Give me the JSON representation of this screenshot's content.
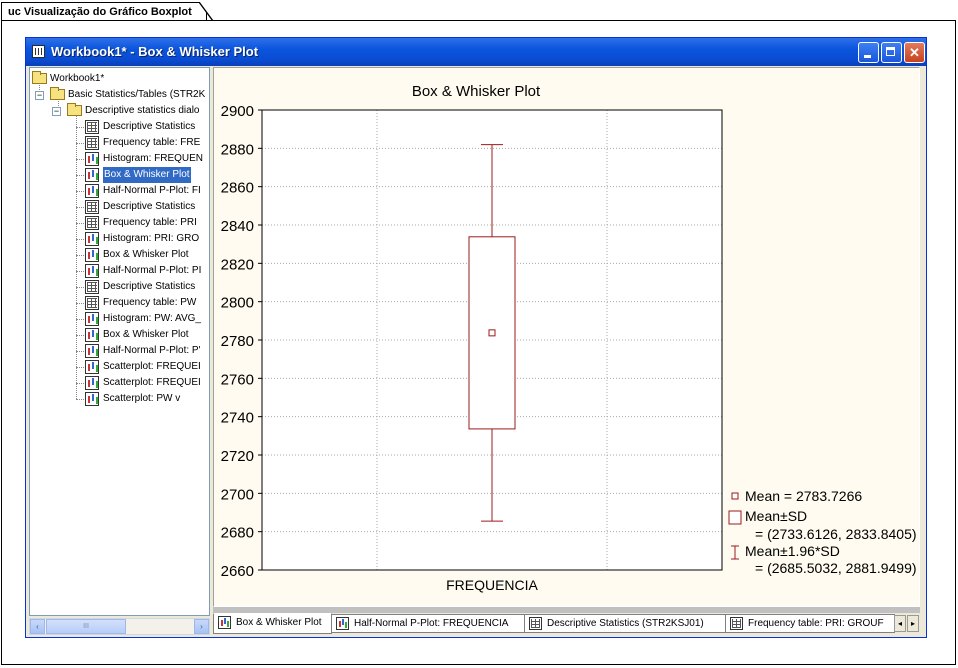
{
  "caption": {
    "title": "uc Visualização do Gráfico Boxplot"
  },
  "window": {
    "title": "Workbook1* - Box & Whisker Plot",
    "buttons": {
      "minimize": "minimize-icon",
      "maximize": "maximize-icon",
      "close": "close-icon"
    }
  },
  "tree": {
    "items": [
      {
        "label": "Workbook1*",
        "icon": "folder-icon"
      },
      {
        "label": "Basic Statistics/Tables (STR2K",
        "icon": "folder-icon"
      },
      {
        "label": "Descriptive statistics dialo",
        "icon": "folder-icon"
      },
      {
        "label": "Descriptive Statistics",
        "icon": "table-icon"
      },
      {
        "label": "Frequency table: FRE",
        "icon": "table-icon"
      },
      {
        "label": "Histogram: FREQUEN",
        "icon": "graph-icon"
      },
      {
        "label": "Box & Whisker Plot",
        "icon": "graph-icon"
      },
      {
        "label": "Half-Normal P-Plot: FI",
        "icon": "graph-icon"
      },
      {
        "label": "Descriptive Statistics",
        "icon": "table-icon"
      },
      {
        "label": "Frequency table: PRI",
        "icon": "table-icon"
      },
      {
        "label": "Histogram: PRI: GRO",
        "icon": "graph-icon"
      },
      {
        "label": "Box & Whisker Plot",
        "icon": "graph-icon"
      },
      {
        "label": "Half-Normal P-Plot: PI",
        "icon": "graph-icon"
      },
      {
        "label": "Descriptive Statistics",
        "icon": "table-icon"
      },
      {
        "label": "Frequency table: PW",
        "icon": "table-icon"
      },
      {
        "label": "Histogram: PW: AVG_",
        "icon": "graph-icon"
      },
      {
        "label": "Box & Whisker Plot",
        "icon": "graph-icon"
      },
      {
        "label": "Half-Normal P-Plot: P'",
        "icon": "graph-icon"
      },
      {
        "label": "Scatterplot: FREQUEI",
        "icon": "graph-icon"
      },
      {
        "label": "Scatterplot: FREQUEI",
        "icon": "graph-icon"
      },
      {
        "label": "Scatterplot: PW       v",
        "icon": "graph-icon"
      }
    ],
    "selected_index": 6,
    "scroll_left": "‹",
    "scroll_right": "›",
    "scroll_grip": "III"
  },
  "tabs": [
    {
      "label": "Box & Whisker Plot",
      "icon": "graph-icon",
      "active": true
    },
    {
      "label": "Half-Normal P-Plot: FREQUENCIA",
      "icon": "graph-icon",
      "active": false
    },
    {
      "label": "Descriptive Statistics (STR2KSJ01)",
      "icon": "table-icon",
      "active": false
    },
    {
      "label": "Frequency table: PRI: GROUF",
      "icon": "table-icon",
      "active": false
    }
  ],
  "tab_nav": {
    "prev": "◂",
    "next": "▸"
  },
  "chart_data": {
    "type": "box",
    "title": "Box & Whisker Plot",
    "categories": [
      "FREQUENCIA"
    ],
    "ylim": [
      2660,
      2900
    ],
    "yticks": [
      2660,
      2680,
      2700,
      2720,
      2740,
      2760,
      2780,
      2800,
      2820,
      2840,
      2860,
      2880,
      2900
    ],
    "grid": true,
    "series": [
      {
        "category": "FREQUENCIA",
        "mean": 2783.7266,
        "box_low": 2733.6126,
        "box_high": 2833.8405,
        "whisker_low": 2685.5032,
        "whisker_high": 2881.9499
      }
    ],
    "color": "#9b1b1b",
    "legend": {
      "position": "bottom-right",
      "entries": [
        {
          "label": "Mean = 2783.7266",
          "sub": ""
        },
        {
          "label": "Mean±SD",
          "sub": "= (2733.6126, 2833.8405)"
        },
        {
          "label": "Mean±1.96*SD",
          "sub": "= (2685.5032, 2881.9499)"
        }
      ]
    }
  }
}
